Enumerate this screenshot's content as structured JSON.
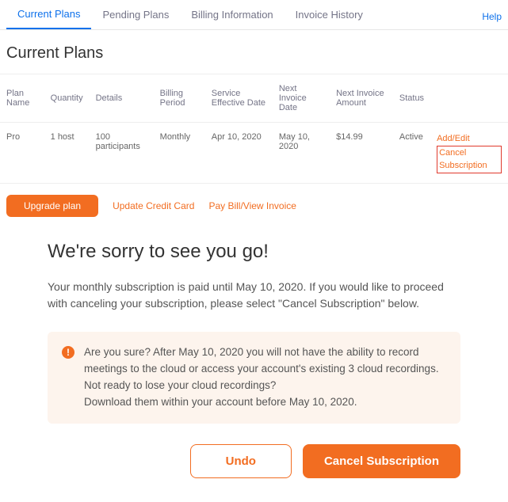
{
  "tabs": {
    "active": "Current Plans",
    "items": [
      "Current Plans",
      "Pending Plans",
      "Billing Information",
      "Invoice History"
    ]
  },
  "help_label": "Help",
  "page_title": "Current Plans",
  "table": {
    "headers": [
      "Plan Name",
      "Quantity",
      "Details",
      "Billing Period",
      "Service Effective Date",
      "Next Invoice Date",
      "Next Invoice Amount",
      "Status"
    ],
    "row": {
      "plan_name": "Pro",
      "quantity": "1 host",
      "details": "100 participants",
      "billing_period": "Monthly",
      "effective_date": "Apr 10, 2020",
      "next_invoice_date": "May 10, 2020",
      "next_invoice_amount": "$14.99",
      "status": "Active",
      "action_add_edit": "Add/Edit",
      "action_cancel": "Cancel Subscription"
    }
  },
  "buttons": {
    "upgrade": "Upgrade plan",
    "update_card": "Update Credit Card",
    "pay_bill": "Pay Bill/View Invoice"
  },
  "dialog": {
    "title": "We're sorry to see you go!",
    "body": "Your monthly subscription is paid until May 10, 2020. If you would like to proceed with canceling your subscription, please select \"Cancel Subscription\" below.",
    "alert_l1": "Are you sure? After May 10, 2020 you will not have the ability to record meetings to the cloud or access your account's existing 3 cloud recordings.",
    "alert_l2": "Not ready to lose your cloud recordings?",
    "alert_l3": "Download them within your account before May 10, 2020.",
    "undo": "Undo",
    "cancel": "Cancel Subscription"
  }
}
